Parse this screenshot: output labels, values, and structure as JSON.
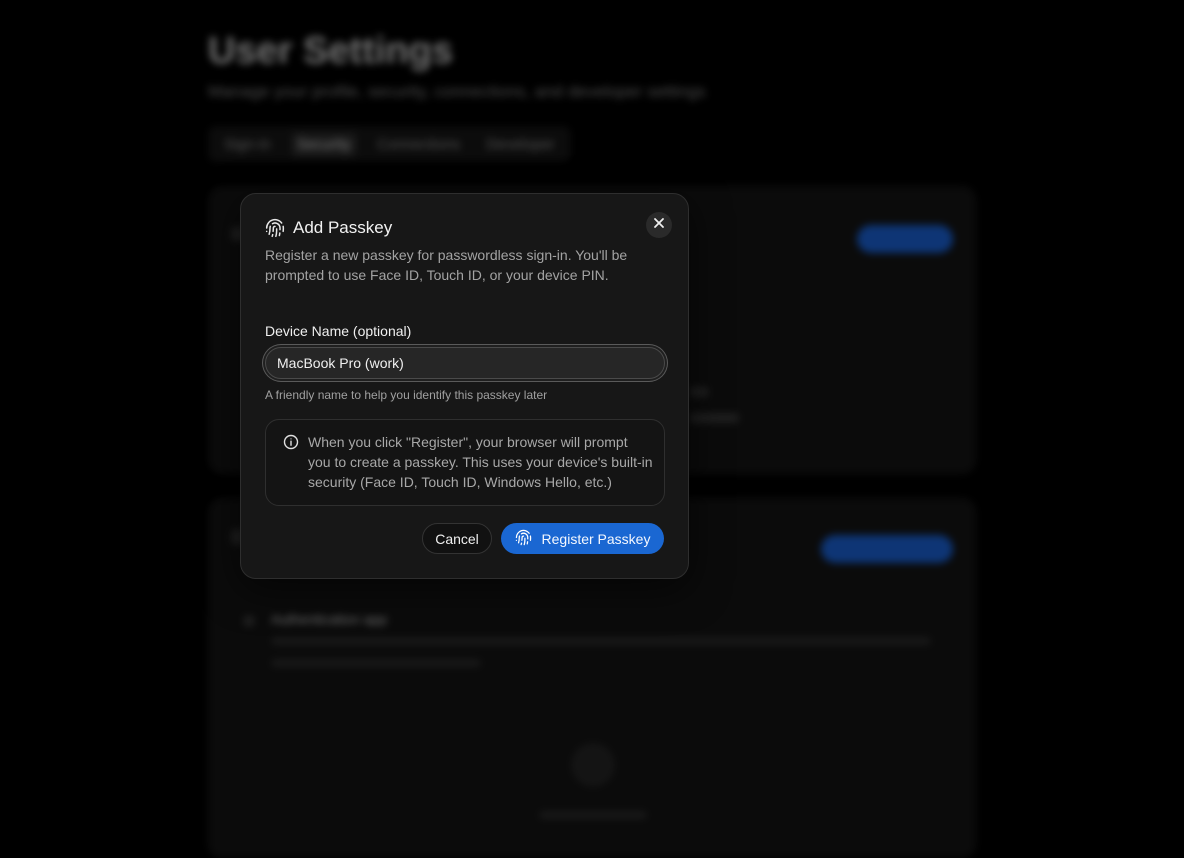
{
  "background": {
    "title": "User Settings",
    "subtitle": "Manage your profile, security, connections, and developer settings",
    "tabs": [
      {
        "label": "Sign-in"
      },
      {
        "label": "Security"
      },
      {
        "label": "Connections"
      },
      {
        "label": "Developer"
      }
    ],
    "card2_item": "Authentication app"
  },
  "modal": {
    "title": "Add Passkey",
    "description": "Register a new passkey for passwordless sign-in. You'll be prompted to use Face ID, Touch ID, or your device PIN.",
    "close_icon": "close-icon",
    "field": {
      "label": "Device Name (optional)",
      "value": "MacBook Pro (work)",
      "help": "A friendly name to help you identify this passkey later"
    },
    "info": {
      "icon": "info-icon",
      "text": "When you click \"Register\", your browser will prompt you to create a passkey. This uses your device's built-in security (Face ID, Touch ID, Windows Hello, etc.)"
    },
    "buttons": {
      "cancel": "Cancel",
      "register": "Register Passkey",
      "register_icon": "fingerprint-icon"
    }
  },
  "colors": {
    "accent": "#1a67d2",
    "modal_bg": "#171717",
    "overlay": "#000000"
  }
}
